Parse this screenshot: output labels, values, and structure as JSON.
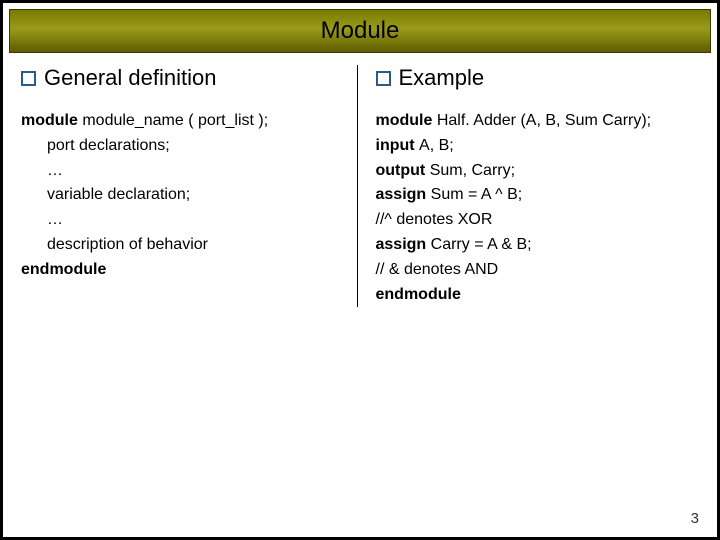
{
  "title": "Module",
  "left": {
    "heading": "General definition",
    "lines": [
      {
        "indent": false,
        "segments": [
          {
            "b": true,
            "t": "module "
          },
          {
            "b": false,
            "t": "module_name ( port_list );"
          }
        ]
      },
      {
        "indent": true,
        "segments": [
          {
            "b": false,
            "t": "port declarations;"
          }
        ]
      },
      {
        "indent": true,
        "segments": [
          {
            "b": false,
            "t": "…"
          }
        ]
      },
      {
        "indent": true,
        "segments": [
          {
            "b": false,
            "t": "variable declaration;"
          }
        ]
      },
      {
        "indent": true,
        "segments": [
          {
            "b": false,
            "t": "…"
          }
        ]
      },
      {
        "indent": true,
        "segments": [
          {
            "b": false,
            "t": "description of behavior"
          }
        ]
      },
      {
        "indent": false,
        "segments": [
          {
            "b": true,
            "t": "endmodule"
          }
        ]
      }
    ]
  },
  "right": {
    "heading": "Example",
    "lines": [
      {
        "indent": false,
        "segments": [
          {
            "b": true,
            "t": "module "
          },
          {
            "b": false,
            "t": "Half. Adder (A, B, Sum Carry);"
          }
        ]
      },
      {
        "indent": false,
        "segments": [
          {
            "b": true,
            "t": "input "
          },
          {
            "b": false,
            "t": "A, B;"
          }
        ]
      },
      {
        "indent": false,
        "segments": [
          {
            "b": true,
            "t": "output "
          },
          {
            "b": false,
            "t": "Sum, Carry;"
          }
        ]
      },
      {
        "indent": false,
        "segments": [
          {
            "b": true,
            "t": "assign "
          },
          {
            "b": false,
            "t": "Sum = A ^ B;"
          }
        ]
      },
      {
        "indent": false,
        "segments": [
          {
            "b": false,
            "t": "//^ denotes XOR"
          }
        ]
      },
      {
        "indent": false,
        "segments": [
          {
            "b": true,
            "t": "assign "
          },
          {
            "b": false,
            "t": "Carry = A & B;"
          }
        ]
      },
      {
        "indent": false,
        "segments": [
          {
            "b": false,
            "t": "// & denotes AND"
          }
        ]
      },
      {
        "indent": false,
        "segments": [
          {
            "b": true,
            "t": "endmodule"
          }
        ]
      }
    ]
  },
  "page_number": "3"
}
